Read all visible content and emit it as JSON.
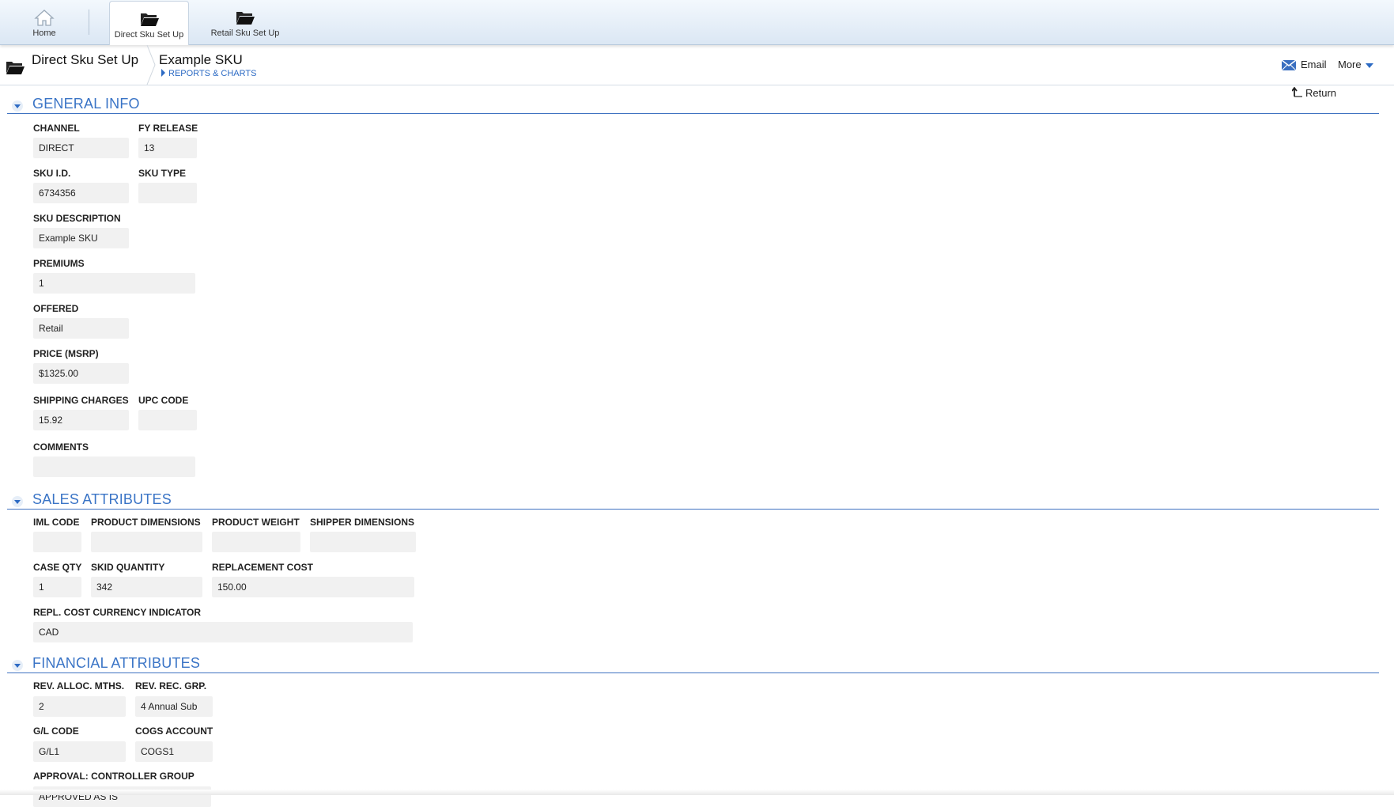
{
  "nav": {
    "tabs": [
      {
        "label": "Home",
        "icon": "home-icon"
      },
      {
        "label": "Direct Sku Set Up",
        "icon": "folder-icon"
      },
      {
        "label": "Retail Sku Set Up",
        "icon": "folder-icon"
      }
    ]
  },
  "header": {
    "module_title": "Direct Sku Set Up",
    "record_title": "Example SKU",
    "reports_link": "REPORTS & CHARTS",
    "email_label": "Email",
    "more_label": "More",
    "return_label": "Return"
  },
  "sections": {
    "general": {
      "title": "GENERAL INFO",
      "channel": {
        "label": "CHANNEL",
        "value": "DIRECT"
      },
      "fy_release": {
        "label": "FY RELEASE",
        "value": "13"
      },
      "sku_id": {
        "label": "SKU I.D.",
        "value": "6734356"
      },
      "sku_type": {
        "label": "SKU TYPE",
        "value": ""
      },
      "sku_description": {
        "label": "SKU DESCRIPTION",
        "value": "Example SKU"
      },
      "premiums": {
        "label": "PREMIUMS",
        "value": "1"
      },
      "offered": {
        "label": "OFFERED",
        "value": "Retail"
      },
      "price": {
        "label": "PRICE (MSRP)",
        "value": "$1325.00"
      },
      "shipping_charges": {
        "label": "SHIPPING CHARGES",
        "value": "15.92"
      },
      "upc_code": {
        "label": "UPC CODE",
        "value": ""
      },
      "comments": {
        "label": "COMMENTS",
        "value": ""
      }
    },
    "sales": {
      "title": "SALES ATTRIBUTES",
      "iml_code": {
        "label": "IML CODE",
        "value": ""
      },
      "product_dimensions": {
        "label": "PRODUCT DIMENSIONS",
        "value": ""
      },
      "product_weight": {
        "label": "PRODUCT WEIGHT",
        "value": ""
      },
      "shipper_dimensions": {
        "label": "SHIPPER DIMENSIONS",
        "value": ""
      },
      "case_qty": {
        "label": "CASE QTY",
        "value": "1"
      },
      "skid_quantity": {
        "label": "SKID QUANTITY",
        "value": "342"
      },
      "replacement_cost": {
        "label": "REPLACEMENT COST",
        "value": "150.00"
      },
      "repl_currency": {
        "label": "REPL. COST CURRENCY INDICATOR",
        "value": "CAD"
      }
    },
    "financial": {
      "title": "FINANCIAL ATTRIBUTES",
      "rev_alloc": {
        "label": "REV. ALLOC. MTHS.",
        "value": "2"
      },
      "rev_rec_grp": {
        "label": "REV. REC. GRP.",
        "value": "4 Annual Sub"
      },
      "gl_code": {
        "label": "G/L CODE",
        "value": "G/L1"
      },
      "cogs_account": {
        "label": "COGS ACCOUNT",
        "value": "COGS1"
      },
      "approval": {
        "label": "APPROVAL: CONTROLLER GROUP",
        "value": "APPROVED AS IS"
      }
    }
  },
  "colors": {
    "accent": "#3a74c6",
    "link": "#2d6bc4",
    "field_bg": "#f1f1f1"
  }
}
